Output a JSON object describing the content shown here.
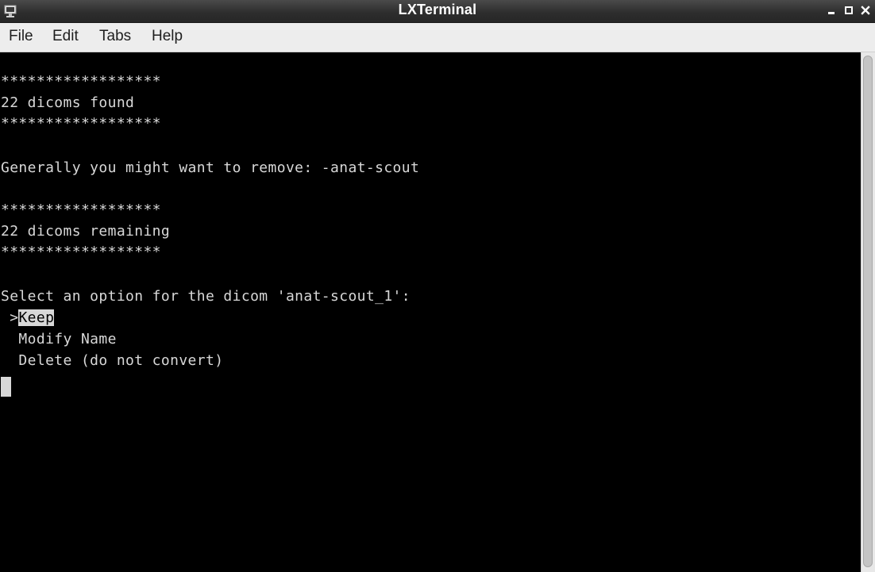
{
  "window": {
    "title": "LXTerminal",
    "app_icon": "terminal-icon",
    "controls": {
      "minimize_icon": "minimize-icon",
      "maximize_icon": "maximize-icon",
      "close_icon": "close-icon"
    }
  },
  "menubar": {
    "items": [
      {
        "label": "File"
      },
      {
        "label": "Edit"
      },
      {
        "label": "Tabs"
      },
      {
        "label": "Help"
      }
    ]
  },
  "terminal": {
    "lines": [
      "******************",
      "22 dicoms found",
      "******************",
      "Generally you might want to remove: -anat-scout",
      "******************",
      "22 dicoms remaining",
      "******************",
      "Select an option for the dicom 'anat-scout_1':"
    ],
    "menu": {
      "pointer": " >",
      "selected": "Keep",
      "options": [
        "  Modify Name",
        "  Delete (do not convert)"
      ]
    },
    "colors": {
      "background": "#000000",
      "foreground": "#d8d8d8"
    }
  }
}
